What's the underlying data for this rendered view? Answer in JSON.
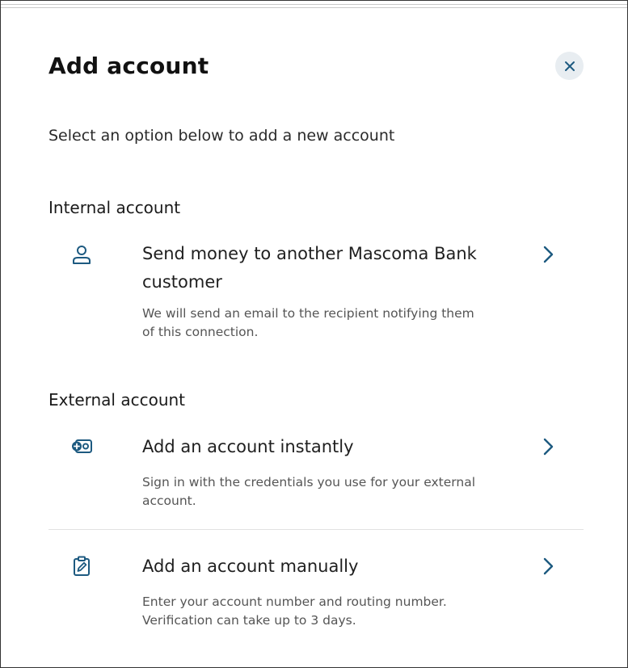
{
  "dialog": {
    "title": "Add account",
    "subtitle": "Select an option below to add a new account",
    "close_icon": "close-icon"
  },
  "sections": {
    "internal": {
      "title": "Internal account",
      "options": [
        {
          "icon": "person-icon",
          "title": "Send money to another Mascoma Bank customer",
          "description": "We will send an email to the recipient notifying them of this connection."
        }
      ]
    },
    "external": {
      "title": "External account",
      "options": [
        {
          "icon": "account-link-icon",
          "title": "Add an account instantly",
          "description": "Sign in with the credentials you use for your external account."
        },
        {
          "icon": "clipboard-edit-icon",
          "title": "Add an account manually",
          "description": "Enter your account number and routing number. Verification can take up to 3 days."
        }
      ]
    }
  },
  "colors": {
    "accent": "#1d5a80",
    "close_bg": "#e8edf1",
    "text": "#1f1f1f",
    "muted": "#555555"
  }
}
